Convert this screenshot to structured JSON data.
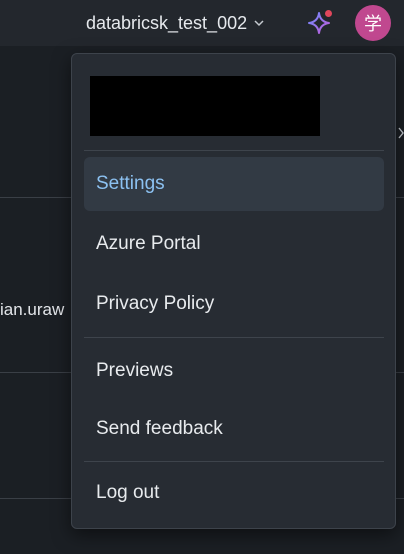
{
  "header": {
    "workspace_name": "databricsk_test_002",
    "avatar_initial": "学"
  },
  "background": {
    "partial_text": "ian.uraw"
  },
  "menu": {
    "items": [
      {
        "label": "Settings",
        "active": true
      },
      {
        "label": "Azure Portal"
      },
      {
        "label": "Privacy Policy"
      },
      {
        "label": "Previews"
      },
      {
        "label": "Send feedback"
      },
      {
        "label": "Log out"
      }
    ]
  },
  "colors": {
    "accent": "#8cc1f1",
    "avatar": "#c0488f",
    "notification_dot": "#e0475c"
  }
}
